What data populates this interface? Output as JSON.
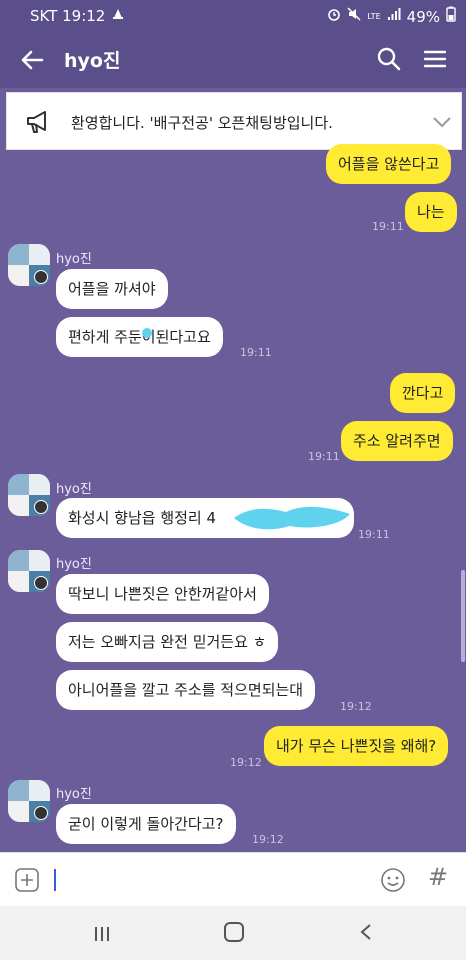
{
  "status_bar": {
    "carrier_time": "SKT 19:12",
    "lte": "LTE",
    "battery": "49%"
  },
  "header": {
    "title": "hyo진"
  },
  "notice": {
    "text": "환영합니다. '배구전공' 오픈채팅방입니다."
  },
  "messages": {
    "m1": {
      "text": "어플을 않쓴다고"
    },
    "m2": {
      "text": "나는",
      "time": "19:11"
    },
    "g1": {
      "sender": "hyo진",
      "line1": "어플을 까셔야",
      "line2": "편하게 주둔이된다고요",
      "time": "19:11"
    },
    "m3": {
      "text": "깐다고"
    },
    "m4": {
      "text": "주소 알려주면",
      "time": "19:11"
    },
    "g2": {
      "sender": "hyo진",
      "line1": "화성시 향남읍 행정리 4",
      "time": "19:11"
    },
    "g3": {
      "sender": "hyo진",
      "line1": "딱보니 나쁜짓은 안한꺼같아서",
      "line2": "저는 오빠지금 완전 믿거든요 ㅎ",
      "line3": "아니어플을 깔고 주소를 적으면되는대",
      "time": "19:12"
    },
    "m5": {
      "text": "내가 무슨 나쁜짓을 왜해?",
      "time": "19:12"
    },
    "g4": {
      "sender": "hyo진",
      "line1": "굳이 이렇게 돌아간다고?",
      "time": "19:12"
    }
  },
  "colors": {
    "background": "#6a5d99",
    "header": "#5a4f8a",
    "my_bubble": "#ffeb33",
    "other_bubble": "#ffffff",
    "redaction": "#5fd3ee"
  },
  "icons": {
    "back": "back-arrow-icon",
    "search": "search-icon",
    "menu": "hamburger-menu-icon",
    "notice": "megaphone-icon",
    "expand": "chevron-down-icon",
    "attach": "plus-icon",
    "emoji": "emoji-icon",
    "hash": "hash-icon"
  },
  "input": {
    "hash_symbol": "#"
  }
}
